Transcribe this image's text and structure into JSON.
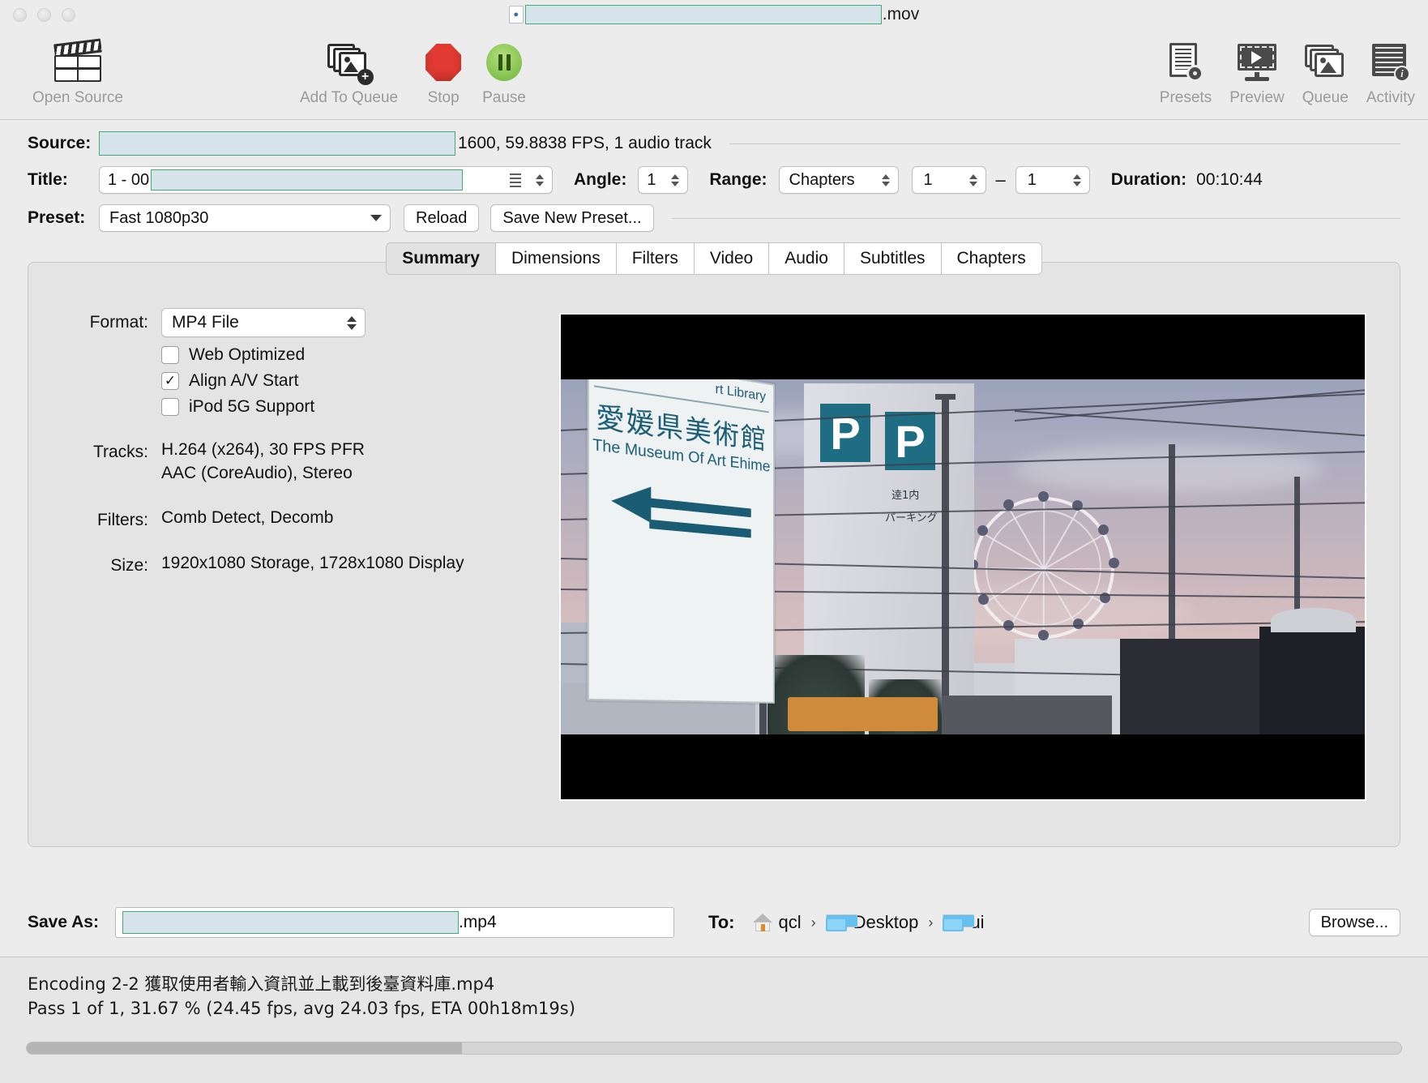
{
  "window": {
    "title_redacted": true,
    "title_extension": ".mov",
    "traffic_lights": [
      "close",
      "minimize",
      "zoom"
    ]
  },
  "toolbar": {
    "items": [
      {
        "label": "Open Source",
        "icon": "clapperboard-icon",
        "name": "open-source-button"
      },
      {
        "label": "Add To Queue",
        "icon": "add-to-queue-icon",
        "name": "add-to-queue-button"
      },
      {
        "label": "Stop",
        "icon": "stop-octagon-icon",
        "name": "stop-button"
      },
      {
        "label": "Pause",
        "icon": "pause-circle-icon",
        "name": "pause-button"
      }
    ],
    "right_items": [
      {
        "label": "Presets",
        "icon": "presets-icon",
        "name": "presets-button"
      },
      {
        "label": "Preview",
        "icon": "preview-monitor-icon",
        "name": "preview-button"
      },
      {
        "label": "Queue",
        "icon": "queue-stack-icon",
        "name": "queue-button"
      },
      {
        "label": "Activity",
        "icon": "activity-log-icon",
        "name": "activity-button"
      }
    ]
  },
  "source": {
    "label": "Source:",
    "value_redacted": true,
    "meta": "1600, 59.8838 FPS, 1 audio track"
  },
  "title_row": {
    "label": "Title:",
    "value_prefix": "1 - 00",
    "angle_label": "Angle:",
    "angle_value": "1",
    "range_label": "Range:",
    "range_type": "Chapters",
    "range_start": "1",
    "range_end": "1",
    "range_dash": "–",
    "duration_label": "Duration:",
    "duration_value": "00:10:44"
  },
  "preset_row": {
    "label": "Preset:",
    "value": "Fast 1080p30",
    "reload_label": "Reload",
    "save_new_label": "Save New Preset..."
  },
  "tabs": [
    {
      "label": "Summary",
      "active": true
    },
    {
      "label": "Dimensions",
      "active": false
    },
    {
      "label": "Filters",
      "active": false
    },
    {
      "label": "Video",
      "active": false
    },
    {
      "label": "Audio",
      "active": false
    },
    {
      "label": "Subtitles",
      "active": false
    },
    {
      "label": "Chapters",
      "active": false
    }
  ],
  "summary": {
    "format_label": "Format:",
    "format_value": "MP4 File",
    "checkboxes": [
      {
        "label": "Web Optimized",
        "checked": false,
        "mark": ""
      },
      {
        "label": "Align A/V Start",
        "checked": true,
        "mark": "✓"
      },
      {
        "label": "iPod 5G Support",
        "checked": false,
        "mark": ""
      }
    ],
    "tracks_label": "Tracks:",
    "tracks_video": "H.264 (x264), 30 FPS PFR",
    "tracks_audio": "AAC (CoreAudio), Stereo",
    "filters_label": "Filters:",
    "filters_value": "Comb Detect, Decomb",
    "size_label": "Size:",
    "size_value": "1920x1080 Storage, 1728x1080 Display"
  },
  "preview": {
    "description": "Dusk street scene in Japan with road sign, parking building and ferris wheel",
    "sign_top_text": "rt Library",
    "sign_japanese": "愛媛県美術館",
    "sign_english": "The Museum Of Art Ehime",
    "parking_letter": "P",
    "parking_jp_1": "逹1内",
    "parking_jp_2": "パーキング",
    "letterbox_color": "#000000"
  },
  "save_as": {
    "label": "Save As:",
    "value_redacted": true,
    "extension": ".mp4",
    "to_label": "To:",
    "breadcrumb": [
      {
        "name": "qcl",
        "icon": "home-icon"
      },
      {
        "name": "Desktop",
        "icon": "folder-icon"
      },
      {
        "name": "ui",
        "icon": "folder-icon"
      }
    ],
    "separator": "›",
    "browse_label": "Browse..."
  },
  "status": {
    "line1": "Encoding 2-2 獲取使用者輸入資訊並上載到後臺資料庫.mp4",
    "line2": "Pass 1 of 1, 31.67 % (24.45 fps, avg 24.03 fps, ETA 00h18m19s)",
    "progress_percent": 31.67
  },
  "colors": {
    "redaction_fill": "#d6e3ea",
    "redaction_border": "#3fae74",
    "stop_red": "#e03a32",
    "pause_green": "#82c24d",
    "window_bg": "#ececec",
    "panel_bg": "#e4e4e4"
  }
}
